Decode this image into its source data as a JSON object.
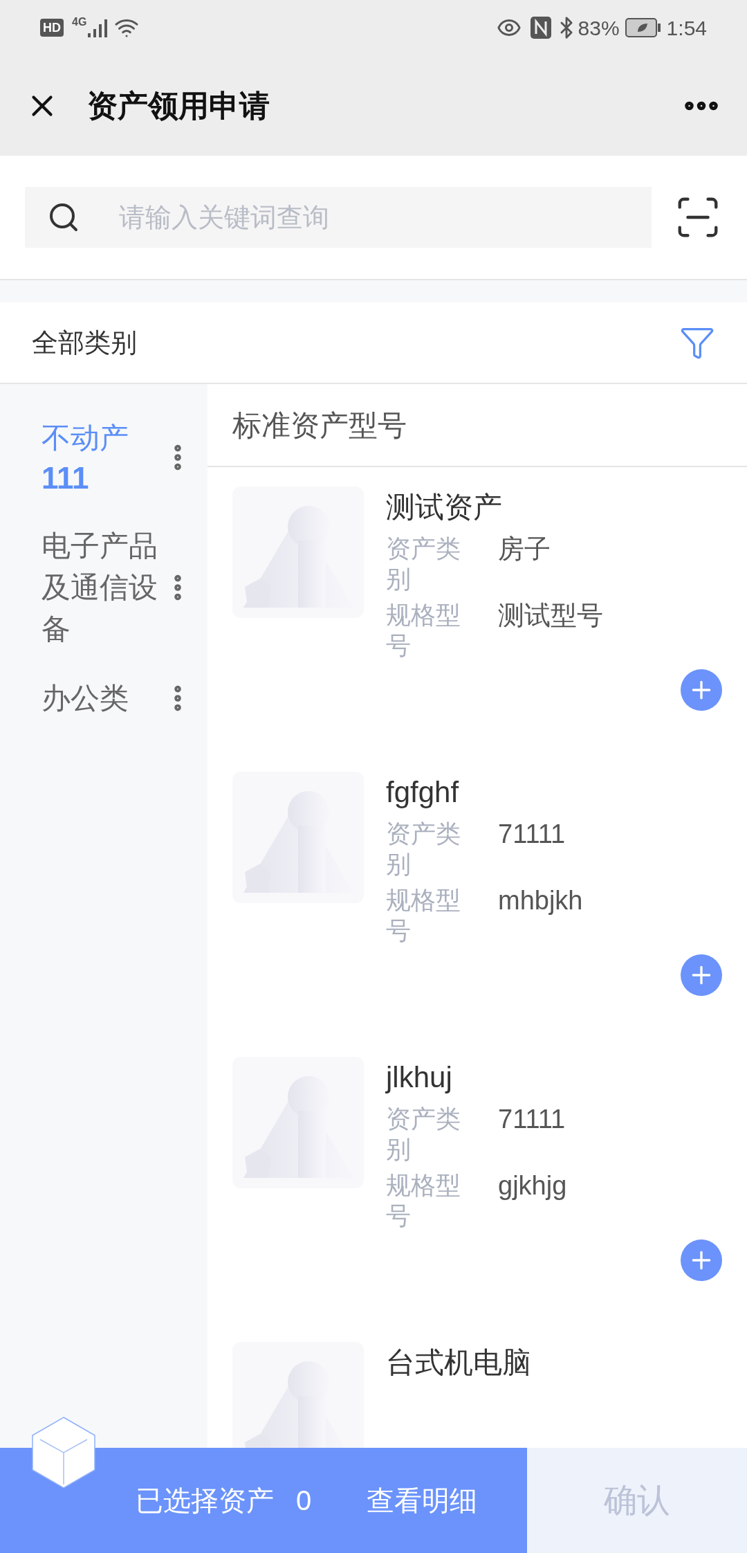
{
  "status_bar": {
    "hd_badge": "HD",
    "network": "4G",
    "battery": "83%",
    "time": "1:54"
  },
  "header": {
    "title": "资产领用申请"
  },
  "search": {
    "placeholder": "请输入关键词查询"
  },
  "filter_bar": {
    "label": "全部类别"
  },
  "sidebar": {
    "items": [
      {
        "name": "不动产",
        "count": "111",
        "selected": true
      },
      {
        "name": "电子产品及通信设备",
        "selected": false
      },
      {
        "name": "办公类",
        "selected": false
      }
    ]
  },
  "content": {
    "heading": "标准资产型号",
    "items": [
      {
        "title": "测试资产",
        "fields": [
          {
            "label": "资产类别",
            "value": "房子"
          },
          {
            "label": "规格型号",
            "value": "测试型号"
          }
        ]
      },
      {
        "title": "fgfghf",
        "fields": [
          {
            "label": "资产类别",
            "value": "71111"
          },
          {
            "label": "规格型号",
            "value": "mhbjkh"
          }
        ]
      },
      {
        "title": "jlkhuj",
        "fields": [
          {
            "label": "资产类别",
            "value": "71111"
          },
          {
            "label": "规格型号",
            "value": "gjkhjg"
          }
        ]
      },
      {
        "title": "台式机电脑"
      }
    ]
  },
  "bottom_bar": {
    "selected_label": "已选择资产",
    "selected_count": "0",
    "details": "查看明细",
    "confirm": "确认"
  }
}
